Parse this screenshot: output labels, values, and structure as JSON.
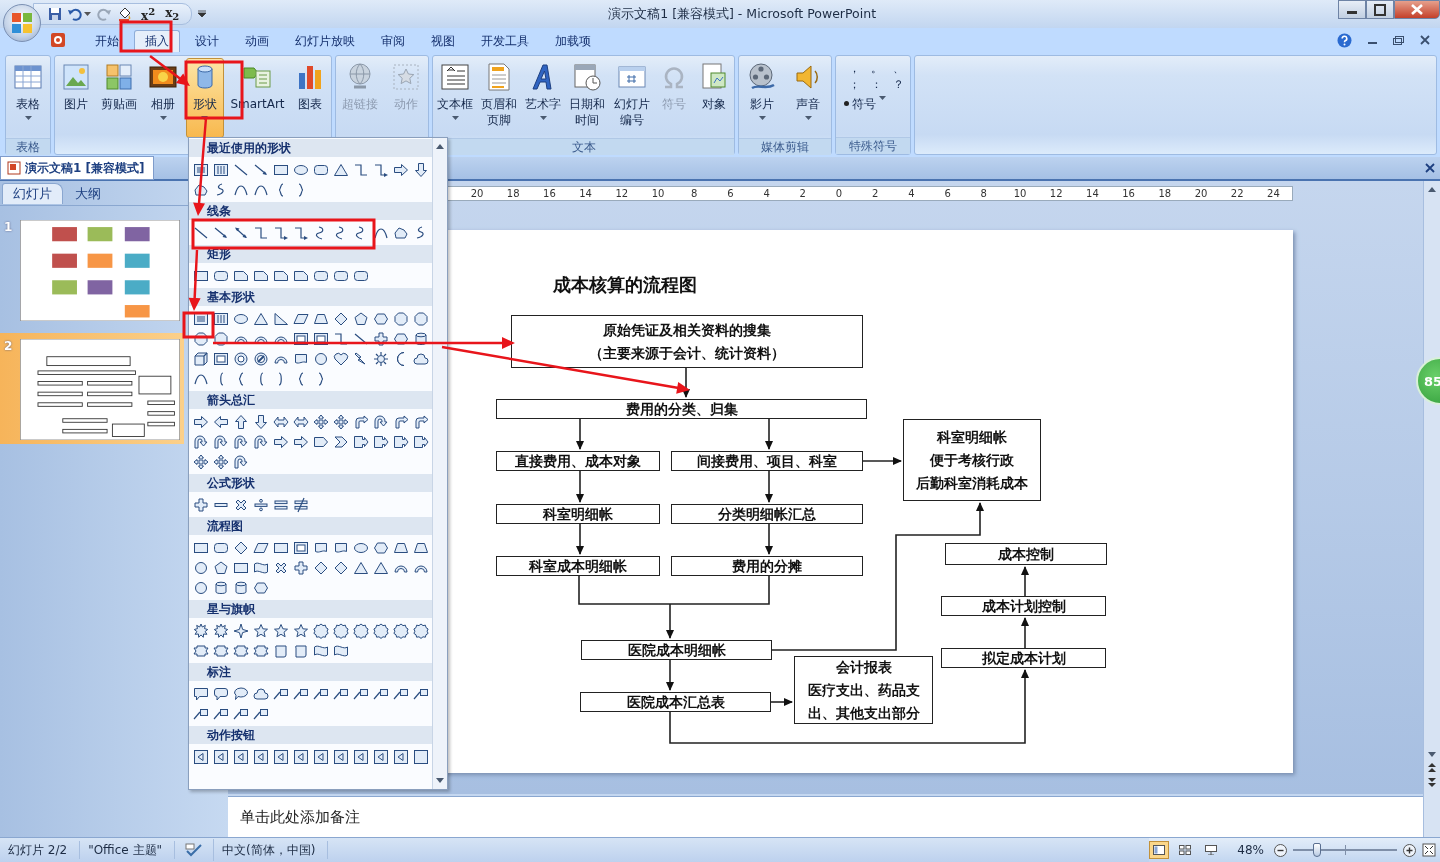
{
  "window": {
    "title": "演示文稿1 [兼容模式] - Microsoft PowerPoint"
  },
  "quick_access": [
    {
      "label": "x$^{2}$"
    },
    {
      "label": "x$_{2}$"
    }
  ],
  "tabs": [
    {
      "label": "开始",
      "selected": false
    },
    {
      "label": "插入",
      "selected": true
    },
    {
      "label": "设计",
      "selected": false
    },
    {
      "label": "动画",
      "selected": false
    },
    {
      "label": "幻灯片放映",
      "selected": false
    },
    {
      "label": "审阅",
      "selected": false
    },
    {
      "label": "视图",
      "selected": false
    },
    {
      "label": "开发工具",
      "selected": false
    },
    {
      "label": "加载项",
      "selected": false
    }
  ],
  "ribbon_groups": [
    {
      "label": "表格",
      "buttons": [
        {
          "label": [
            "表格"
          ],
          "dropdown": true,
          "disabled": false,
          "pressed": false
        }
      ]
    },
    {
      "buttons": [
        {
          "label": [
            "图片"
          ],
          "dropdown": false,
          "disabled": false,
          "pressed": false
        },
        {
          "label": [
            "剪贴画"
          ],
          "dropdown": false,
          "disabled": false,
          "pressed": false
        },
        {
          "label": [
            "相册"
          ],
          "dropdown": true,
          "disabled": false,
          "pressed": false
        },
        {
          "label": [
            "形状"
          ],
          "dropdown": true,
          "disabled": false,
          "pressed": true
        },
        {
          "label": [
            "SmartArt"
          ],
          "dropdown": false,
          "disabled": false,
          "pressed": false
        },
        {
          "label": [
            "图表"
          ],
          "dropdown": false,
          "disabled": false,
          "pressed": false
        }
      ]
    },
    {
      "buttons": [
        {
          "label": [
            "超链接"
          ],
          "dropdown": false,
          "disabled": true,
          "pressed": false
        },
        {
          "label": [
            "动作"
          ],
          "dropdown": false,
          "disabled": true,
          "pressed": false
        }
      ]
    },
    {
      "label": "文本",
      "buttons": [
        {
          "label": [
            "文本框"
          ],
          "dropdown": true,
          "disabled": false,
          "pressed": false
        },
        {
          "label": [
            "页眉和",
            "页脚"
          ],
          "dropdown": false,
          "disabled": false,
          "pressed": false
        },
        {
          "label": [
            "艺术字"
          ],
          "dropdown": true,
          "disabled": false,
          "pressed": false
        },
        {
          "label": [
            "日期和",
            "时间"
          ],
          "dropdown": false,
          "disabled": false,
          "pressed": false
        },
        {
          "label": [
            "幻灯片",
            "编号"
          ],
          "dropdown": false,
          "disabled": false,
          "pressed": false
        },
        {
          "label": [
            "符号"
          ],
          "dropdown": false,
          "disabled": true,
          "pressed": false
        },
        {
          "label": [
            "对象"
          ],
          "dropdown": false,
          "disabled": false,
          "pressed": false
        }
      ]
    },
    {
      "label": "媒体剪辑",
      "buttons": [
        {
          "label": [
            "影片"
          ],
          "dropdown": true,
          "disabled": false,
          "pressed": false
        },
        {
          "label": [
            "声音"
          ],
          "dropdown": true,
          "disabled": false,
          "pressed": false
        }
      ]
    }
  ],
  "special_group": {
    "label": "特殊符号",
    "symbols": [
      "，",
      "。",
      "、",
      "；",
      "：",
      "？"
    ],
    "menu_button": "符号"
  },
  "document_tab": {
    "title": "演示文稿1 [兼容模式]"
  },
  "left_panel": {
    "tabs": [
      {
        "label": "幻灯片",
        "selected": true
      },
      {
        "label": "大纲",
        "selected": false
      }
    ],
    "slides": [
      {
        "number": "1",
        "selected": false
      },
      {
        "number": "2",
        "selected": true
      }
    ]
  },
  "ruler": [
    "20",
    "18",
    "16",
    "14",
    "12",
    "10",
    "8",
    "6",
    "4",
    "2",
    "0",
    "2",
    "4",
    "6",
    "8",
    "10",
    "12",
    "14",
    "16",
    "18",
    "20",
    "22",
    "24"
  ],
  "slide": {
    "title": "成本核算的流程图",
    "nodes": [
      {
        "lines": [
          "原始凭证及相关资料的搜集",
          "（主要来源于会计、统计资料）"
        ]
      },
      {
        "lines": [
          "费用的分类、归集"
        ]
      },
      {
        "lines": [
          "直接费用、成本对象"
        ]
      },
      {
        "lines": [
          "间接费用、项目、科室"
        ]
      },
      {
        "lines": [
          "科室明细帐",
          "便于考核行政",
          "后勤科室消耗成本"
        ]
      },
      {
        "lines": [
          "科室明细帐"
        ]
      },
      {
        "lines": [
          "分类明细帐汇总"
        ]
      },
      {
        "lines": [
          "科室成本明细帐"
        ]
      },
      {
        "lines": [
          "费用的分摊"
        ]
      },
      {
        "lines": [
          "医院成本明细帐"
        ]
      },
      {
        "lines": [
          "医院成本汇总表"
        ]
      },
      {
        "lines": [
          "会计报表",
          "医疗支出、药品支",
          "出、其他支出部分"
        ]
      },
      {
        "lines": [
          "成本控制"
        ]
      },
      {
        "lines": [
          "成本计划控制"
        ]
      },
      {
        "lines": [
          "拟定成本计划"
        ]
      }
    ]
  },
  "shape_gallery": {
    "sections": [
      {
        "title": "最近使用的形状"
      },
      {
        "title": "线条"
      },
      {
        "title": "矩形"
      },
      {
        "title": "基本形状"
      },
      {
        "title": "箭头总汇"
      },
      {
        "title": "公式形状"
      },
      {
        "title": "流程图"
      },
      {
        "title": "星与旗帜"
      },
      {
        "title": "标注"
      },
      {
        "title": "动作按钮"
      }
    ]
  },
  "notes": {
    "prompt": "单击此处添加备注"
  },
  "side_badge": {
    "text": "85"
  },
  "status_bar": {
    "slide": "幻灯片 2/2",
    "theme": "\"Office 主题\"",
    "language": "中文(简体，中国)",
    "views": [
      {
        "selected": true
      },
      {
        "selected": false
      },
      {
        "selected": false
      }
    ],
    "zoom": "48%",
    "zoom_slider": {
      "level": 0.23
    }
  }
}
